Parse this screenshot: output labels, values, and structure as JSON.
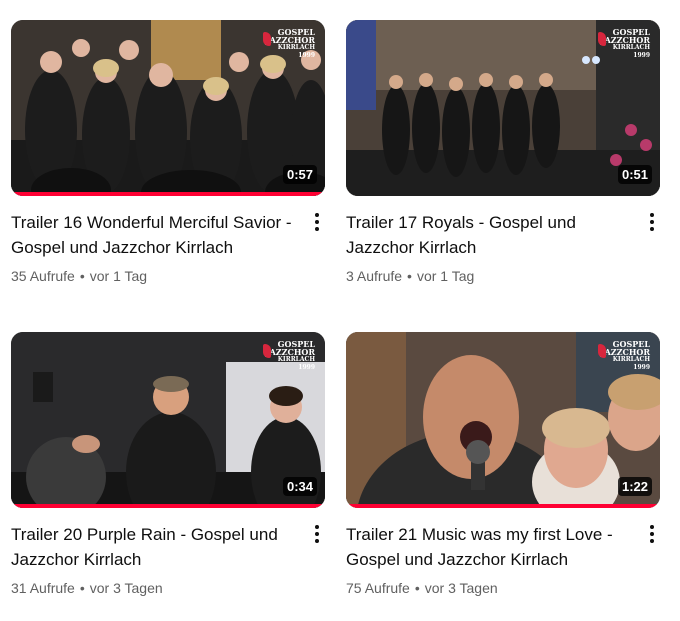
{
  "videos": [
    {
      "title": "Trailer 16 Wonderful Merciful Savior - Gospel und Jazzchor Kirrlach",
      "duration": "0:57",
      "views": "35 Aufrufe",
      "age": "vor 1 Tag",
      "watched_fraction": 1.0,
      "logo": [
        "GOSPEL",
        "JAZZCHOR",
        "KIRRLACH 1999"
      ]
    },
    {
      "title": "Trailer 17 Royals - Gospel und Jazzchor Kirrlach",
      "duration": "0:51",
      "views": "3 Aufrufe",
      "age": "vor 1 Tag",
      "watched_fraction": 0.0,
      "logo": [
        "GOSPEL",
        "JAZZCHOR",
        "KIRRLACH 1999"
      ]
    },
    {
      "title": "Trailer 20 Purple Rain - Gospel und Jazzchor Kirrlach",
      "duration": "0:34",
      "views": "31 Aufrufe",
      "age": "vor 3 Tagen",
      "watched_fraction": 1.0,
      "logo": [
        "GOSPEL",
        "JAZZCHOR",
        "KIRRLACH 1999"
      ]
    },
    {
      "title": "Trailer 21 Music was my first Love - Gospel und Jazzchor Kirrlach",
      "duration": "1:22",
      "views": "75 Aufrufe",
      "age": "vor 3 Tagen",
      "watched_fraction": 1.0,
      "logo": [
        "GOSPEL",
        "JAZZCHOR",
        "KIRRLACH 1999"
      ]
    }
  ],
  "separator": "•",
  "colors": {
    "progress": "#ff0033",
    "meta_text": "#606060",
    "title_text": "#0f0f0f"
  }
}
